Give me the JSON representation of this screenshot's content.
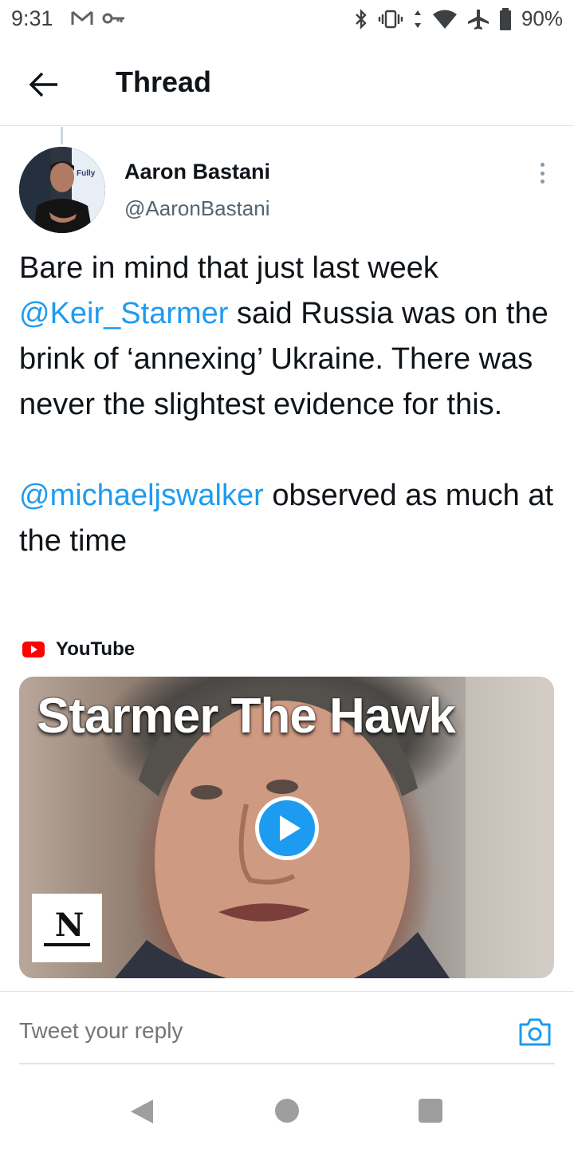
{
  "status_bar": {
    "time": "9:31",
    "left_icons": [
      "gmail-icon",
      "key-icon"
    ],
    "right_icons": [
      "bluetooth-icon",
      "vibrate-icon",
      "data-arrows-icon",
      "wifi-icon",
      "airplane-icon",
      "battery-icon"
    ],
    "battery": "90%"
  },
  "header": {
    "title": "Thread"
  },
  "tweet": {
    "author_name": "Aaron Bastani",
    "author_handle": "@AaronBastani",
    "avatar_text": "Fully",
    "text_line1_a": "Bare in mind that just last week",
    "mention1": "@Keir_Starmer",
    "text_line2_b": " said Russia was on the brink of ‘annexing’ Ukraine. There was never the slightest evidence for this.",
    "mention2": "@michaeljswalker",
    "text_line3_b": " observed as much at the time"
  },
  "card": {
    "source": "YouTube",
    "title_overlay": "Starmer The Hawk",
    "logo_text": "N"
  },
  "reply": {
    "placeholder": "Tweet your reply"
  },
  "colors": {
    "accent": "#1d9bf0",
    "text": "#0f1419",
    "secondary": "#536471",
    "youtube_red": "#ff0000"
  }
}
